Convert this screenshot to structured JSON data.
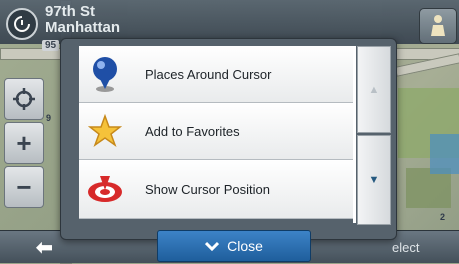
{
  "header": {
    "street_line1": "97th St",
    "street_line2": "Manhattan",
    "route_badge": "95"
  },
  "map": {
    "labels": [
      "9",
      "2"
    ]
  },
  "menu": {
    "items": [
      {
        "label": "Places Around Cursor",
        "icon": "map-pin-icon"
      },
      {
        "label": "Add to Favorites",
        "icon": "star-icon"
      },
      {
        "label": "Show Cursor Position",
        "icon": "target-icon"
      }
    ],
    "close_label": "Close"
  },
  "footer": {
    "select_label": "elect"
  },
  "colors": {
    "accent": "#2a6fb3",
    "topbar": "#4a5661",
    "menu_bg": "#ffffff"
  }
}
